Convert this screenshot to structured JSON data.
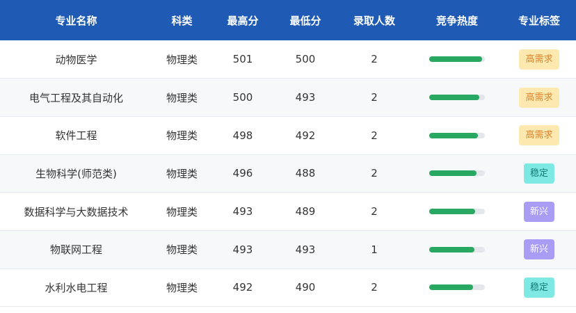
{
  "table": {
    "headers": [
      "专业名称",
      "科类",
      "最高分",
      "最低分",
      "录取人数",
      "竞争热度",
      "专业标签"
    ],
    "rows": [
      {
        "name": "动物医学",
        "category": "物理类",
        "max": "501",
        "min": "500",
        "count": "2",
        "heat": 0.95,
        "tag": "高需求",
        "tag_style": "high"
      },
      {
        "name": "电气工程及其自动化",
        "category": "物理类",
        "max": "500",
        "min": "493",
        "count": "2",
        "heat": 0.9,
        "tag": "高需求",
        "tag_style": "high"
      },
      {
        "name": "软件工程",
        "category": "物理类",
        "max": "498",
        "min": "492",
        "count": "2",
        "heat": 0.88,
        "tag": "高需求",
        "tag_style": "high"
      },
      {
        "name": "生物科学(师范类)",
        "category": "物理类",
        "max": "496",
        "min": "488",
        "count": "2",
        "heat": 0.85,
        "tag": "稳定",
        "tag_style": "stable"
      },
      {
        "name": "数据科学与大数据技术",
        "category": "物理类",
        "max": "493",
        "min": "489",
        "count": "2",
        "heat": 0.83,
        "tag": "新兴",
        "tag_style": "new"
      },
      {
        "name": "物联网工程",
        "category": "物理类",
        "max": "493",
        "min": "493",
        "count": "1",
        "heat": 0.81,
        "tag": "新兴",
        "tag_style": "new"
      },
      {
        "name": "水利水电工程",
        "category": "物理类",
        "max": "492",
        "min": "490",
        "count": "2",
        "heat": 0.79,
        "tag": "稳定",
        "tag_style": "stable"
      }
    ]
  },
  "tag_colors": {
    "high": {
      "bg": "#fde9b0",
      "fg": "#d9822b"
    },
    "stable": {
      "bg": "#7ee8e2",
      "fg": "#127a76"
    },
    "new": {
      "bg": "#a99cf5",
      "fg": "#ffffff"
    }
  },
  "colors": {
    "header_bg": "#1f5bb4",
    "heat_fill": "#28a860",
    "heat_track": "#e3e6eb"
  }
}
